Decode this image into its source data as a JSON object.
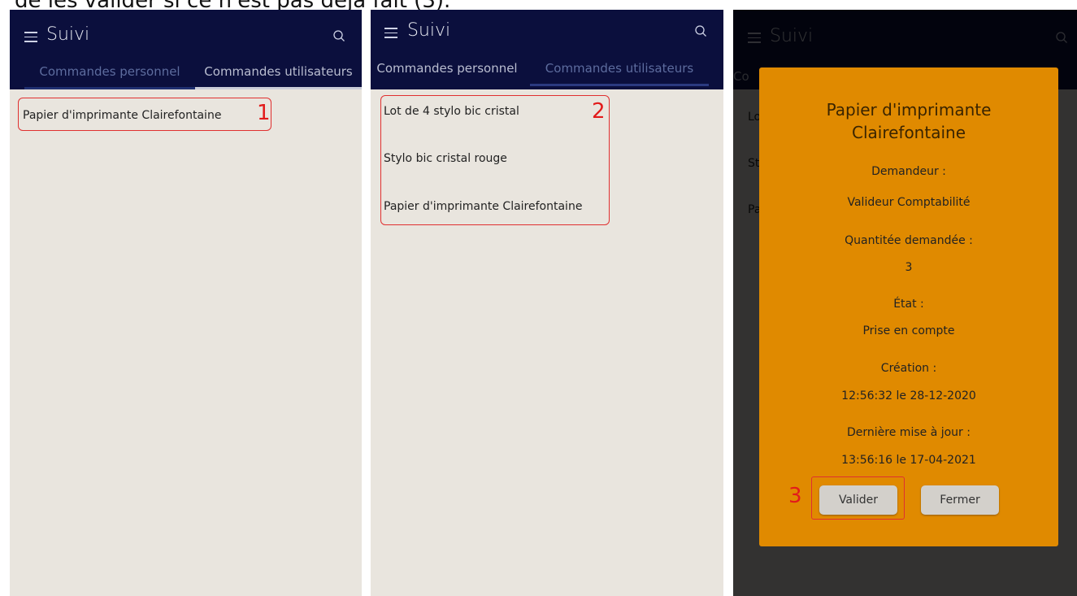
{
  "caption": "de les valider si ce n'est pas déjà fait (3).",
  "app": {
    "title": "Suivi",
    "tabs": [
      "Commandes personnel",
      "Commandes utilisateurs"
    ]
  },
  "panel1": {
    "items": [
      "Papier d'imprimante Clairefontaine"
    ],
    "marker": "1"
  },
  "panel2": {
    "items": [
      "Lot de 4 stylo bic cristal",
      "Stylo bic cristal rouge",
      "Papier d'imprimante Clairefontaine"
    ],
    "marker": "2"
  },
  "panel3": {
    "bg_items": [
      "Lo",
      "St",
      "Pa"
    ],
    "bg_tab": "Co",
    "modal": {
      "title_line1": "Papier d'imprimante",
      "title_line2": "Clairefontaine",
      "requester_label": "Demandeur :",
      "requester_value": "Valideur Comptabilité",
      "quantity_label": "Quantitée demandée :",
      "quantity_value": "3",
      "state_label": "État :",
      "state_value": "Prise en compte",
      "created_label": "Création :",
      "created_value": "12:56:32 le 28-12-2020",
      "updated_label": "Dernière mise à jour :",
      "updated_value": "13:56:16 le 17-04-2021",
      "validate_label": "Valider",
      "close_label": "Fermer"
    },
    "marker": "3"
  },
  "colors": {
    "appbar": "#0b0f3d",
    "background": "#e9e5de",
    "modal": "#e08a00",
    "highlight": "#e03030"
  },
  "icons": [
    "menu-icon",
    "search-icon"
  ]
}
